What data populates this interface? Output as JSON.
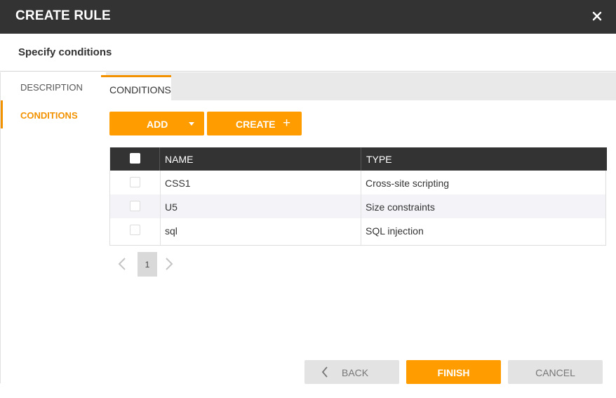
{
  "dialog": {
    "title": "CREATE RULE",
    "close_icon": "close-icon",
    "subtitle": "Specify conditions"
  },
  "sidebar": {
    "items": [
      {
        "label": "DESCRIPTION",
        "active": false
      },
      {
        "label": "CONDITIONS",
        "active": true
      }
    ]
  },
  "main": {
    "tabs": [
      {
        "label": "CONDITIONS",
        "active": true
      }
    ],
    "toolbar": {
      "add_label": "ADD",
      "add_icon": "caret-down-icon",
      "create_label": "CREATE",
      "create_icon": "+"
    },
    "table": {
      "columns": [
        "NAME",
        "TYPE"
      ],
      "rows": [
        {
          "name": "CSS1",
          "type": "Cross-site scripting",
          "checked": false
        },
        {
          "name": "U5",
          "type": "Size constraints",
          "checked": false
        },
        {
          "name": "sql",
          "type": "SQL injection",
          "checked": false
        }
      ]
    },
    "pagination": {
      "current_page": "1",
      "prev_icon": "chevron-left-icon",
      "next_icon": "chevron-right-icon"
    }
  },
  "footer": {
    "back_label": "BACK",
    "finish_label": "FINISH",
    "cancel_label": "CANCEL"
  },
  "colors": {
    "accent": "#ff9c00",
    "header_bg": "#333333",
    "disabled_bg": "#e3e3e3"
  }
}
